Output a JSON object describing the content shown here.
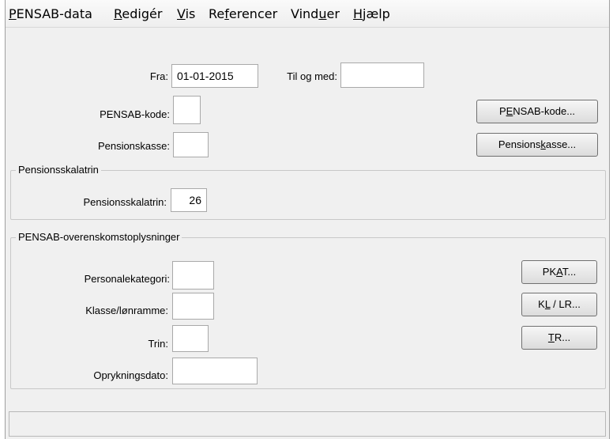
{
  "menu": {
    "pensab_data": {
      "u": "P",
      "rest": "ENSAB-data"
    },
    "rediger": {
      "u": "R",
      "rest": "edigér"
    },
    "vis": {
      "u": "V",
      "rest": "is"
    },
    "referencer": {
      "pre": "Re",
      "u": "f",
      "rest": "erencer"
    },
    "vinduer": {
      "pre": "Vind",
      "u": "u",
      "rest": "er"
    },
    "hjaelp": {
      "u": "H",
      "rest": "jælp"
    }
  },
  "form": {
    "fra_label": "Fra:",
    "fra_value": "01-01-2015",
    "til_label": "Til og med:",
    "til_value": "",
    "pensab_kode_label": "PENSAB-kode:",
    "pensab_kode_value": "",
    "pensionskasse_label": "Pensionskasse:",
    "pensionskasse_value": ""
  },
  "buttons": {
    "pensab_kode": {
      "pre": "P",
      "u": "E",
      "rest": "NSAB-kode..."
    },
    "pensionskasse": {
      "pre": "Pensions",
      "u": "k",
      "rest": "asse..."
    },
    "pkat": {
      "pre": "PK",
      "u": "A",
      "rest": "T..."
    },
    "kl_lr": {
      "pre": "K",
      "u": "L",
      "rest": " / LR..."
    },
    "tr": {
      "pre": "",
      "u": "T",
      "rest": "R..."
    }
  },
  "skalatrin_group": {
    "title": "Pensionsskalatrin",
    "label": "Pensionsskalatrin:",
    "value": "26"
  },
  "overens_group": {
    "title": "PENSAB-overenskomstoplysninger",
    "personalekategori_label": "Personalekategori:",
    "personalekategori_value": "",
    "klasse_label": "Klasse/lønramme:",
    "klasse_value": "",
    "trin_label": "Trin:",
    "trin_value": "",
    "oprykningsdato_label": "Oprykningsdato:",
    "oprykningsdato_value": ""
  },
  "status": {
    "text": ""
  }
}
